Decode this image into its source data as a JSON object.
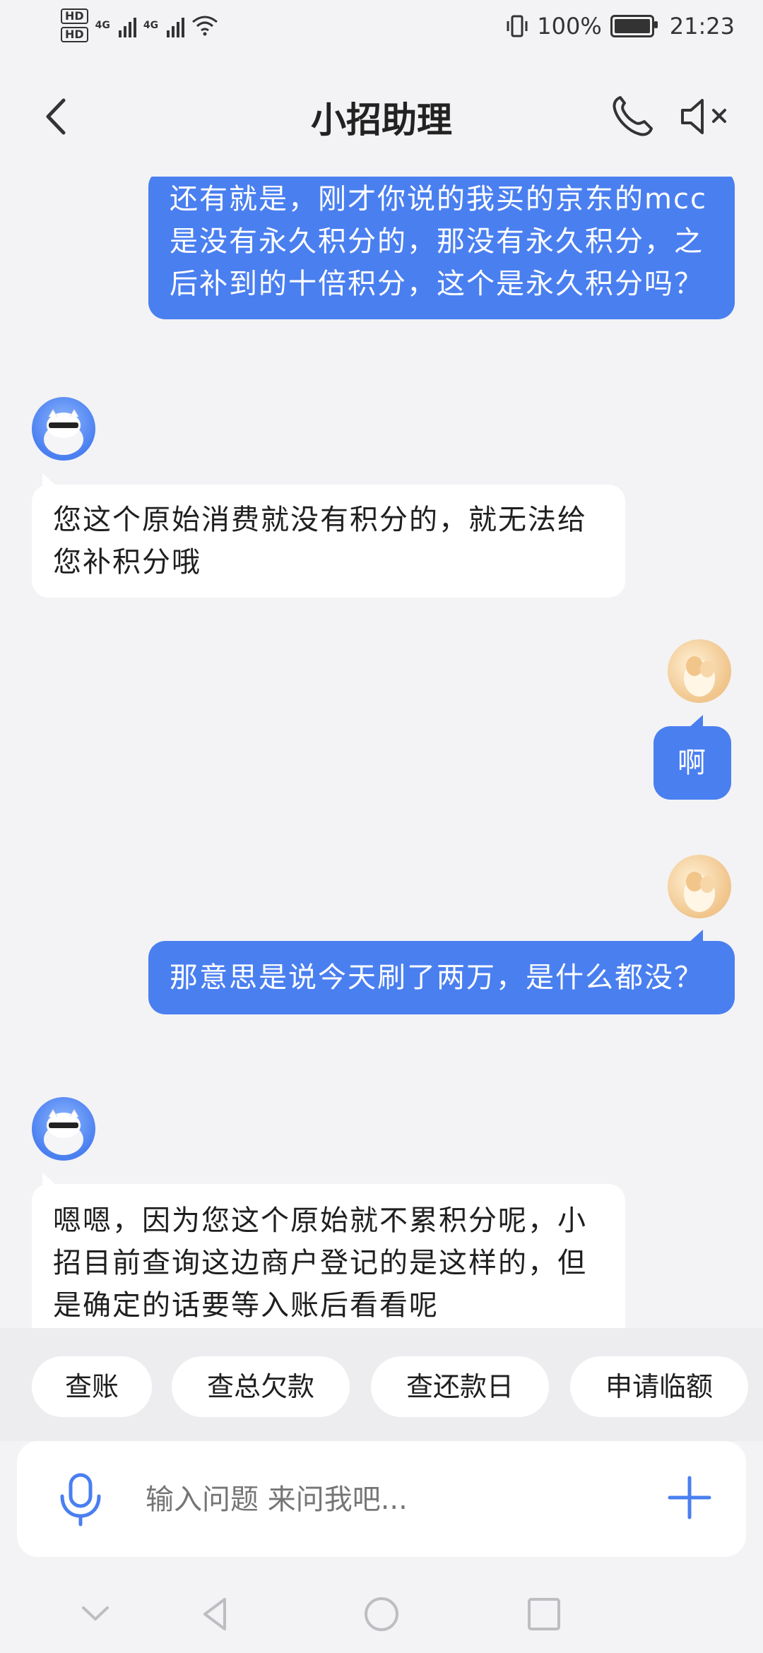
{
  "status_bar": {
    "left": {
      "hd1": "HD",
      "hd2": "HD",
      "net1": "4G",
      "net2": "4G"
    },
    "right": {
      "battery_pct": "100%",
      "time": "21:23"
    }
  },
  "header": {
    "title": "小招助理"
  },
  "messages": [
    {
      "role": "user",
      "text": "还有就是，刚才你说的我买的京东的mcc是没有永久积分的，那没有永久积分，之后补到的十倍积分，这个是永久积分吗？"
    },
    {
      "role": "bot",
      "text": "您这个原始消费就没有积分的，就无法给您补积分哦"
    },
    {
      "role": "user",
      "text": "啊"
    },
    {
      "role": "user",
      "text": "那意思是说今天刷了两万，是什么都没？"
    },
    {
      "role": "bot",
      "text": "嗯嗯，因为您这个原始就不累积分呢，小招目前查询这边商户登记的是这样的，但是确定的话要等入账后看看呢"
    }
  ],
  "quick_actions": [
    "查账",
    "查总欠款",
    "查还款日",
    "申请临额"
  ],
  "input": {
    "placeholder": "输入问题 来问我吧..."
  },
  "colors": {
    "accent": "#4a7ff0",
    "user_bubble": "#4a7ff0",
    "bot_bubble": "#ffffff",
    "background": "#f3f3f5"
  }
}
